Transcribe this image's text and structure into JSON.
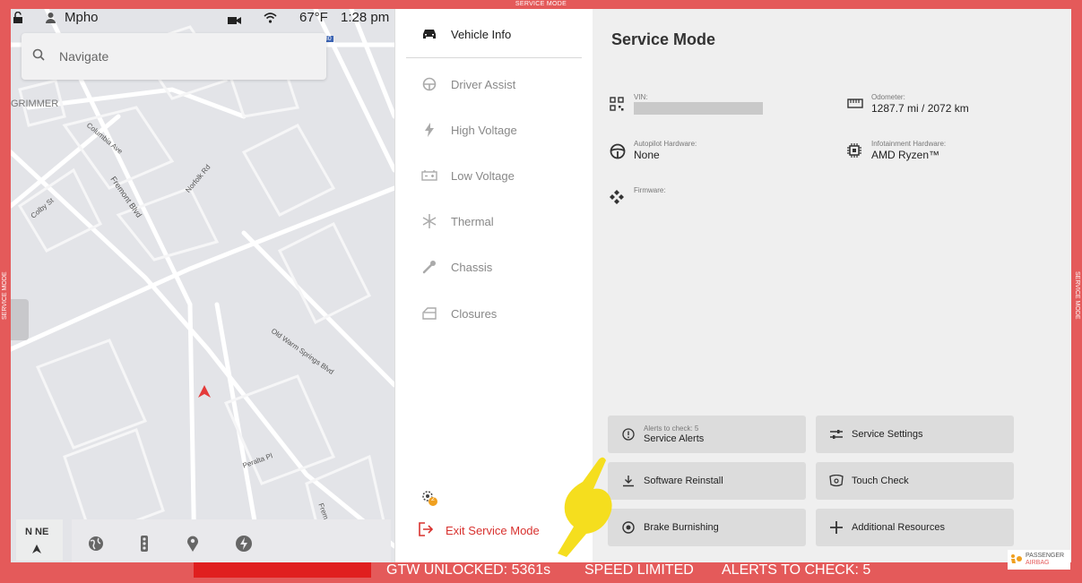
{
  "frame": {
    "label": "SERVICE MODE"
  },
  "status_bar": {
    "user": "Mpho",
    "temperature": "67°F",
    "time": "1:28 pm"
  },
  "search": {
    "placeholder": "Navigate"
  },
  "map": {
    "labels": [
      "GRIMMER",
      "Columbia Ave",
      "Fremont Blvd",
      "Norfolk Rd",
      "Colby St",
      "Old Warm Springs Blvd",
      "Peralta Pl",
      "Fremont Blvd"
    ],
    "compass": "N NE",
    "shield": "880"
  },
  "nav": {
    "items": [
      {
        "label": "Vehicle Info",
        "icon": "car-icon"
      },
      {
        "label": "Driver Assist",
        "icon": "steering-wheel-icon"
      },
      {
        "label": "High Voltage",
        "icon": "lightning-icon"
      },
      {
        "label": "Low Voltage",
        "icon": "battery-icon"
      },
      {
        "label": "Thermal",
        "icon": "snowflake-icon"
      },
      {
        "label": "Chassis",
        "icon": "wrench-icon"
      },
      {
        "label": "Closures",
        "icon": "door-icon"
      }
    ],
    "notification_count": "2",
    "exit_label": "Exit Service Mode"
  },
  "main": {
    "title": "Service Mode",
    "info": {
      "vin_label": "VIN:",
      "odometer_label": "Odometer:",
      "odometer_value": "1287.7 mi / 2072 km",
      "autopilot_label": "Autopilot Hardware:",
      "autopilot_value": "None",
      "infotainment_label": "Infotainment Hardware:",
      "infotainment_value": "AMD Ryzen™",
      "firmware_label": "Firmware:"
    },
    "buttons": {
      "service_alerts_sub": "Alerts to check: 5",
      "service_alerts": "Service Alerts",
      "service_settings": "Service Settings",
      "software_reinstall": "Software Reinstall",
      "touch_check": "Touch Check",
      "brake_burnishing": "Brake Burnishing",
      "additional_resources": "Additional Resources"
    }
  },
  "bottom": {
    "gtw": "GTW UNLOCKED: 5361s",
    "speed": "SPEED LIMITED",
    "alerts": "ALERTS TO CHECK: 5"
  },
  "airbag": {
    "line1": "PASSENGER",
    "line2": "AIRBAG"
  },
  "colors": {
    "frame": "#e45a5a",
    "accent_red": "#d8322f",
    "pointer": "#f5de1e"
  }
}
